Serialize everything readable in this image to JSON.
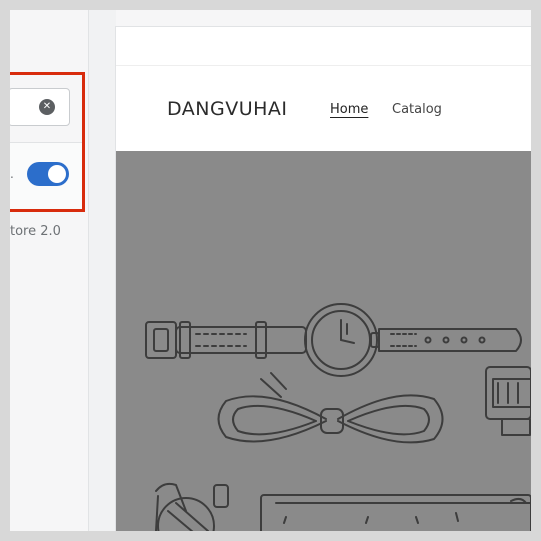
{
  "editor": {
    "search": {
      "value": "",
      "clear_icon": "close-circle-icon"
    },
    "toggle": {
      "state": "on",
      "label_tail": ".",
      "accent": "#2c6ecb"
    },
    "theme_version_text": "tore 2.0"
  },
  "preview": {
    "store_name": "DANGVUHAI",
    "nav": {
      "home": "Home",
      "catalog": "Catalog"
    },
    "hero": {
      "illustration": "watch-bowtie-wallet-illustration",
      "background": "#8a8a8a"
    }
  },
  "colors": {
    "highlight": "#d82c0d",
    "accent": "#2c6ecb"
  }
}
